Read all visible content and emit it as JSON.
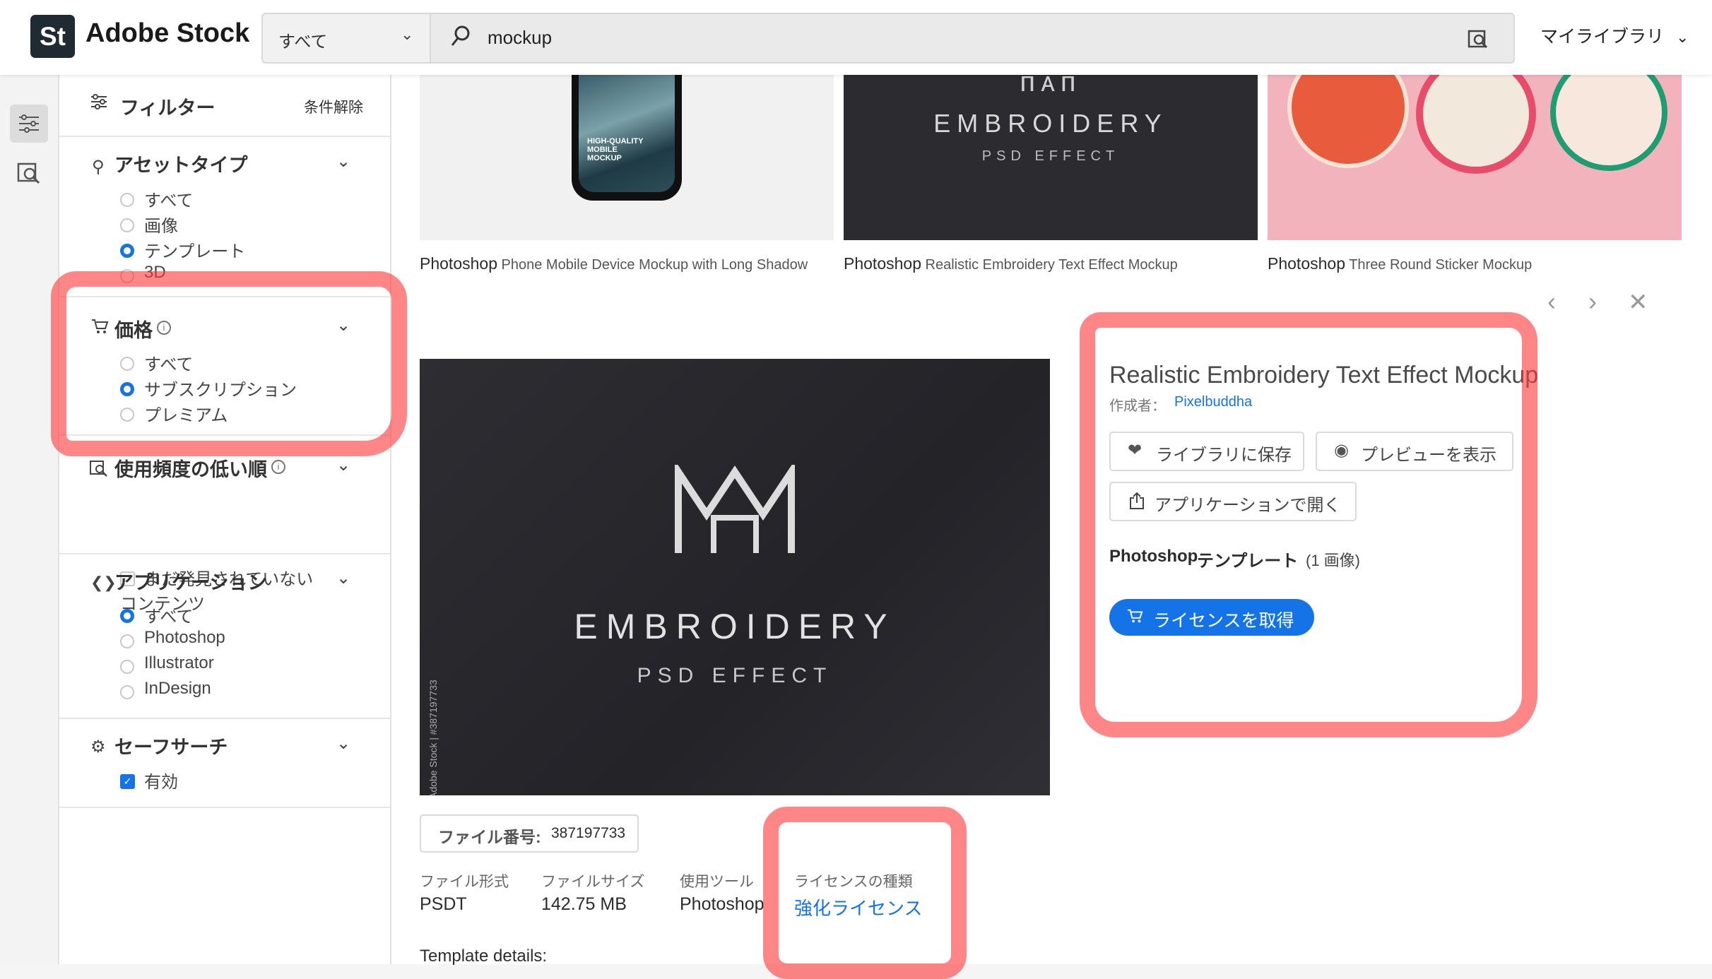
{
  "header": {
    "logo_mark": "St",
    "logo_text": "Adobe Stock",
    "scope_label": "すべて",
    "search_value": "mockup",
    "library_label": "マイライブラリ"
  },
  "filters": {
    "title": "フィルター",
    "clear": "条件解除",
    "asset_type": {
      "title": "アセットタイプ",
      "options": [
        "すべて",
        "画像",
        "テンプレート",
        "3D"
      ],
      "selected": "テンプレート"
    },
    "price": {
      "title": "価格",
      "options": [
        "すべて",
        "サブスクリプション",
        "プレミアム"
      ],
      "selected": "サブスクリプション"
    },
    "undiscovered": {
      "title": "使用頻度の低い順",
      "option_line1": "まだ発見されていない",
      "option_line2": "コンテンツ"
    },
    "application": {
      "title": "アプリケーション",
      "options": [
        "すべて",
        "Photoshop",
        "Illustrator",
        "InDesign"
      ],
      "selected": "すべて"
    },
    "safe_search": {
      "title": "セーフサーチ",
      "option": "有効",
      "checked": true
    }
  },
  "results": [
    {
      "app": "Photoshop",
      "title": "Phone Mobile Device Mockup with Long Shadow",
      "phone_text": "HIGH-QUALITY MOBILE MOCKUP"
    },
    {
      "app": "Photoshop",
      "title": "Realistic Embroidery Text Effect Mockup",
      "line1": "EMBROIDERY",
      "line2": "PSD EFFECT"
    },
    {
      "app": "Photoshop",
      "title": "Three Round Sticker Mockup"
    }
  ],
  "detail": {
    "preview_line1": "EMBROIDERY",
    "preview_line2": "PSD EFFECT",
    "watermark": "Adobe Stock | #387197733",
    "title": "Realistic Embroidery Text Effect Mockup",
    "creator_label": "作成者：",
    "creator_name": "Pixelbuddha",
    "save_label": "ライブラリに保存",
    "preview_label": "プレビューを表示",
    "open_label": "アプリケーションで開く",
    "type_app": "Photoshop",
    "type_kind": "テンプレート",
    "type_count": "(1 画像)",
    "license_button": "ライセンスを取得",
    "file_number_label": "ファイル番号:",
    "file_number": "387197733",
    "meta": [
      {
        "label": "ファイル形式",
        "value": "PSDT"
      },
      {
        "label": "ファイルサイズ",
        "value": "142.75 MB"
      },
      {
        "label": "使用ツール",
        "value": "Photoshop"
      },
      {
        "label": "ライセンスの種類",
        "value": "強化ライセンス"
      }
    ],
    "template_details": "Template details:"
  },
  "colors": {
    "accent": "#1473e6",
    "marker": "#ff3c3c",
    "dark_fabric": "#2b2b30",
    "sticker_bg": "#f2b3bd"
  }
}
